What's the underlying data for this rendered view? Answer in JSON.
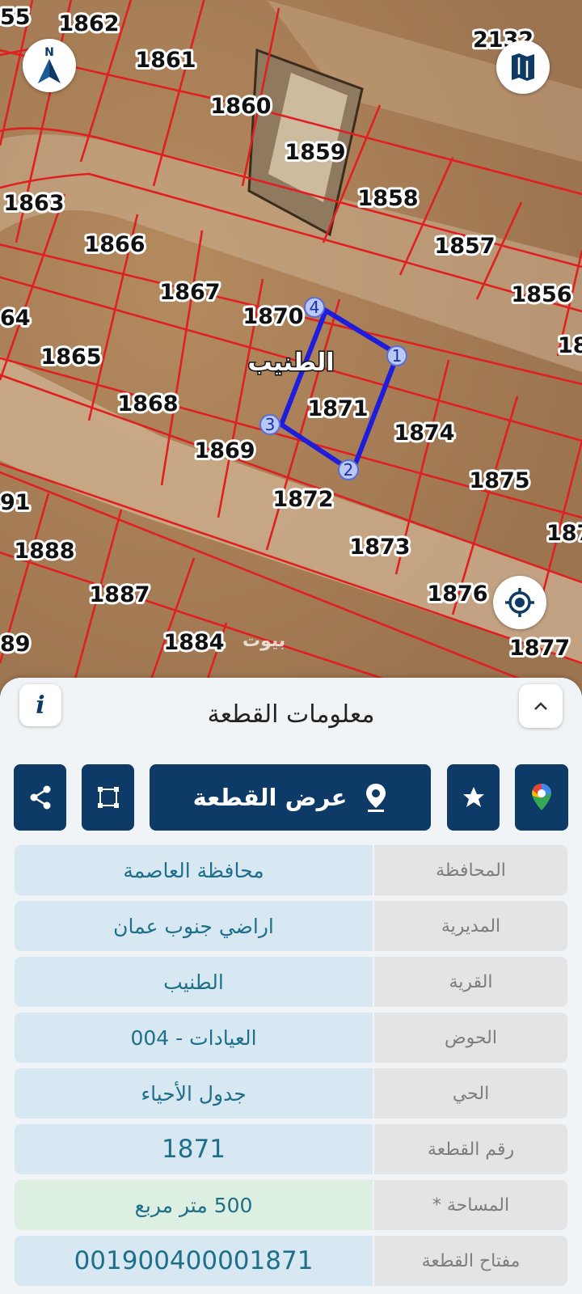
{
  "map": {
    "plots": [
      {
        "id": "1862",
        "label": "1862"
      },
      {
        "id": "1861",
        "label": "1861"
      },
      {
        "id": "1860",
        "label": "1860"
      },
      {
        "id": "1859",
        "label": "1859"
      },
      {
        "id": "1858",
        "label": "1858"
      },
      {
        "id": "1857",
        "label": "1857"
      },
      {
        "id": "1856",
        "label": "1856"
      },
      {
        "id": "1863",
        "label": "1863"
      },
      {
        "id": "1866",
        "label": "1866"
      },
      {
        "id": "1867",
        "label": "1867"
      },
      {
        "id": "1870",
        "label": "1870"
      },
      {
        "id": "1865",
        "label": "1865"
      },
      {
        "id": "1868",
        "label": "1868"
      },
      {
        "id": "1869",
        "label": "1869"
      },
      {
        "id": "1871",
        "label": "1871"
      },
      {
        "id": "1874",
        "label": "1874"
      },
      {
        "id": "1875",
        "label": "1875"
      },
      {
        "id": "1872",
        "label": "1872"
      },
      {
        "id": "1873",
        "label": "1873"
      },
      {
        "id": "1876",
        "label": "1876"
      },
      {
        "id": "1888",
        "label": "1888"
      },
      {
        "id": "1887",
        "label": "1887"
      },
      {
        "id": "1884",
        "label": "1884"
      },
      {
        "id": "p55",
        "label": "55"
      },
      {
        "id": "p2132",
        "label": "2132"
      },
      {
        "id": "p64",
        "label": "64"
      },
      {
        "id": "p18",
        "label": "18"
      },
      {
        "id": "p91",
        "label": "91"
      },
      {
        "id": "p187",
        "label": "187"
      },
      {
        "id": "p89",
        "label": "89"
      },
      {
        "id": "p1877",
        "label": "1877"
      }
    ],
    "area_name": "الطنيب",
    "corners": [
      "1",
      "2",
      "3",
      "4"
    ],
    "watermark": "بيوت",
    "colors": {
      "boundary": "#e02020",
      "selection": "#1d1ddb",
      "ground": "#a97f55",
      "road": "#d9c0a2"
    }
  },
  "map_controls": {
    "compass_icon": "north-arrow-icon",
    "compass_letter": "N",
    "layers_icon": "map-layers-icon",
    "locate_icon": "my-location-icon"
  },
  "panel": {
    "title": "معلومات القطعة",
    "info_icon_text": "i",
    "collapse_icon": "chevron-up-icon",
    "view_plot_label": "عرض القطعة",
    "action_icons": [
      "share-icon",
      "polygon-icon",
      "location-pin-icon",
      "favorite-icon",
      "google-maps-icon"
    ],
    "primary_color": "#0d3a66",
    "rows": [
      {
        "label": "المحافظة",
        "value": "محافظة العاصمة"
      },
      {
        "label": "المديرية",
        "value": "اراضي جنوب عمان"
      },
      {
        "label": "القرية",
        "value": "الطنيب"
      },
      {
        "label": "الحوض",
        "value": "العيادات - 004"
      },
      {
        "label": "الحي",
        "value": "جدول الأحياء"
      },
      {
        "label": "رقم القطعة",
        "value": "1871"
      },
      {
        "label": "المساحة *",
        "value": "500  متر مربع"
      },
      {
        "label": "مفتاح القطعة",
        "value": "001900400001871"
      }
    ]
  }
}
